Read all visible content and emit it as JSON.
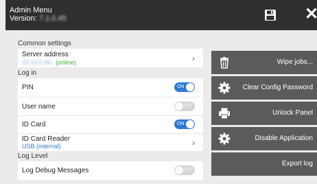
{
  "header": {
    "title": "Admin Menu",
    "version_label": "Version:",
    "version_value": "7.1.0.45",
    "save_icon": "save-icon",
    "close_icon": "close-icon"
  },
  "sections": {
    "common": "Common settings",
    "login": "Log in",
    "loglevel": "Log Level"
  },
  "server": {
    "label": "Server address",
    "address": "10.14.5.56",
    "status": "(online)",
    "status_color": "#3fae3f",
    "chevron": "chevron-right-icon"
  },
  "login": {
    "pin": {
      "label": "PIN",
      "state": "ON"
    },
    "username": {
      "label": "User name",
      "state": "OFF"
    },
    "idcard": {
      "label": "ID Card",
      "state": "ON"
    },
    "reader": {
      "label": "ID Card Reader",
      "value": "USB (internal)",
      "value_color": "#2f79d4"
    }
  },
  "loglevel": {
    "debug": {
      "label": "Log Debug Messages",
      "state": "OFF"
    }
  },
  "actions": [
    {
      "label": "Wipe jobs...",
      "icon": "trash-icon"
    },
    {
      "label": "Clear Config Password",
      "icon": "gear-icon"
    },
    {
      "label": "Unlock Panel",
      "icon": "printer-icon"
    },
    {
      "label": "Disable Application",
      "icon": "gear-icon"
    },
    {
      "label": "Export log",
      "icon": ""
    }
  ],
  "colors": {
    "header_bg": "#2f2f2f",
    "toggle_on": "#2f79d4",
    "action_bg": "#5b5b5b"
  }
}
